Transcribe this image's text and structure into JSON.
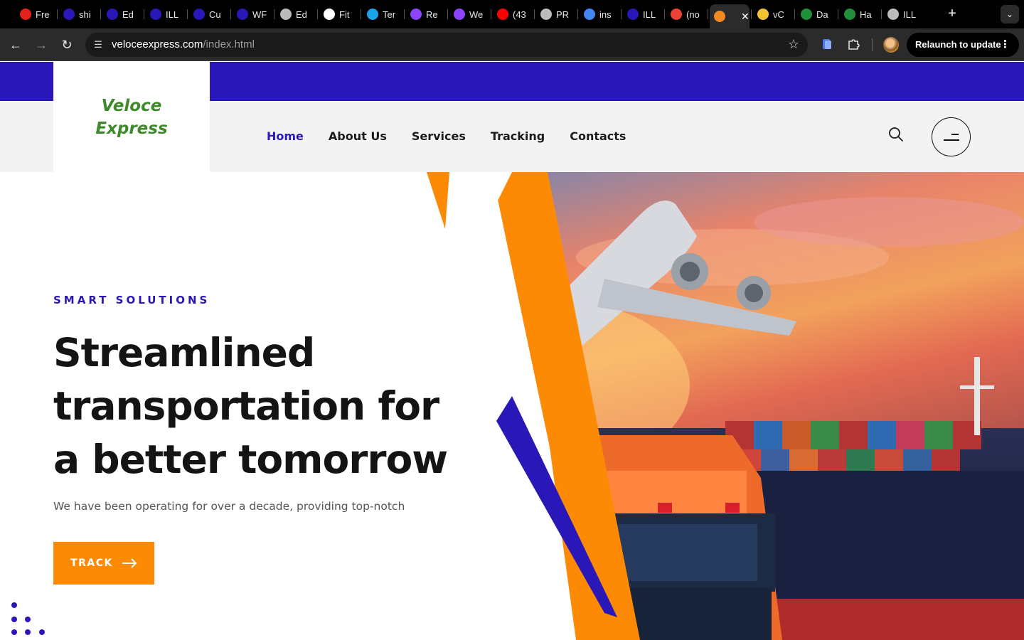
{
  "browser": {
    "tabs": [
      {
        "title": "Fre",
        "icon": "red-shape-icon",
        "color": "#e2231a"
      },
      {
        "title": "shi",
        "icon": "site-icon",
        "color": "#2a17b8"
      },
      {
        "title": "Ed",
        "icon": "site-icon",
        "color": "#2a17b8"
      },
      {
        "title": "ILL",
        "icon": "site-icon",
        "color": "#2a17b8"
      },
      {
        "title": "Cu",
        "icon": "site-icon",
        "color": "#2a17b8"
      },
      {
        "title": "WF",
        "icon": "site-icon",
        "color": "#2a17b8"
      },
      {
        "title": "Ed",
        "icon": "globe-icon",
        "color": "#bbbbbb"
      },
      {
        "title": "Fit",
        "icon": "openai-icon",
        "color": "#ffffff"
      },
      {
        "title": "Ter",
        "icon": "canva-icon",
        "color": "#1aa3e8"
      },
      {
        "title": "Re",
        "icon": "heart-icon",
        "color": "#8e44ff"
      },
      {
        "title": "We",
        "icon": "heart-icon",
        "color": "#8e44ff"
      },
      {
        "title": "(43",
        "icon": "youtube-icon",
        "color": "#ff0000"
      },
      {
        "title": "PR",
        "icon": "globe-icon",
        "color": "#bbbbbb"
      },
      {
        "title": "ins",
        "icon": "google-icon",
        "color": "#4285f4"
      },
      {
        "title": "ILL",
        "icon": "site-icon",
        "color": "#2a17b8"
      },
      {
        "title": "(no",
        "icon": "gmail-icon",
        "color": "#ea4335"
      },
      {
        "title": "",
        "icon": "site-icon",
        "color": "#f08a24",
        "active": true
      },
      {
        "title": "vC",
        "icon": "site-icon",
        "color": "#f4c430"
      },
      {
        "title": "Da",
        "icon": "site-icon",
        "color": "#1f8f3a"
      },
      {
        "title": "Ha",
        "icon": "site-icon",
        "color": "#1f8f3a"
      },
      {
        "title": "ILL",
        "icon": "globe-icon",
        "color": "#bbbbbb"
      }
    ],
    "url_host": "veloceexpress.com",
    "url_path": "/index.html",
    "relaunch_label": "Relaunch to update"
  },
  "site": {
    "logo_line1": "Veloce",
    "logo_line2": "Express",
    "nav": [
      "Home",
      "About Us",
      "Services",
      "Tracking",
      "Contacts"
    ],
    "active_nav": "Home",
    "hero": {
      "eyebrow": "SMART SOLUTIONS",
      "title_lines": [
        "Streamlined",
        "transportation for",
        "a better tomorrow"
      ],
      "description": "We have been operating for over a decade, providing top-notch",
      "button_label": "TRACK"
    }
  },
  "colors": {
    "brand_blue": "#2a17b8",
    "brand_orange": "#fd8a05",
    "logo_green": "#3e8a2b"
  }
}
